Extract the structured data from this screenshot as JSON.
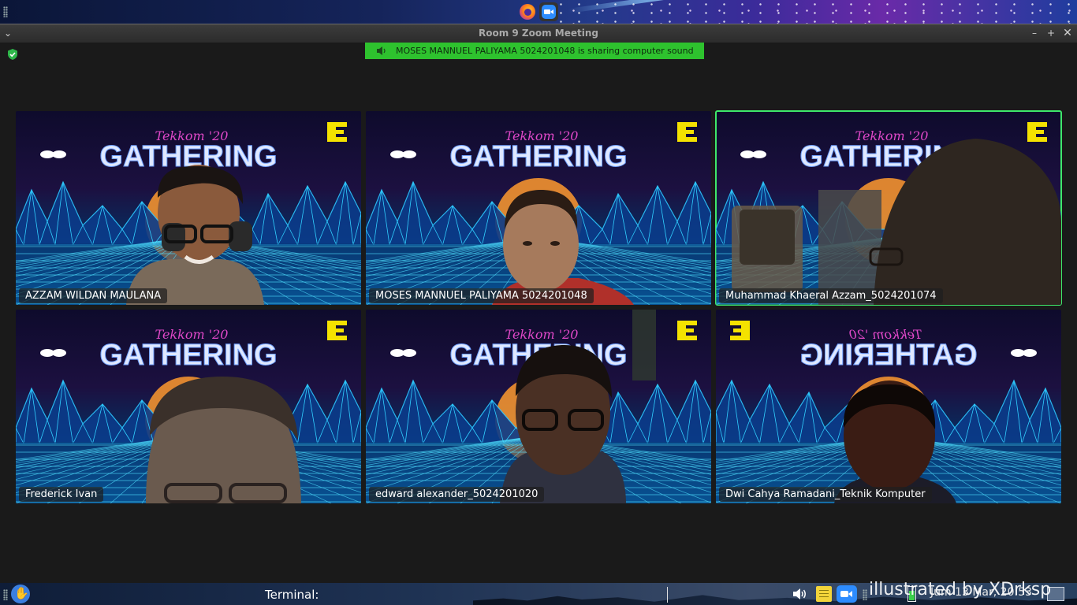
{
  "window": {
    "title": "Room 9   Zoom Meeting",
    "buttons": {
      "menu": "⌄",
      "minimize": "–",
      "maximize": "+",
      "close": "✕"
    }
  },
  "banner": {
    "text": "MOSES MANNUEL PALIYAMA 5024201048 is sharing computer sound",
    "color": "#2ec22e"
  },
  "tiles": [
    {
      "name": "AZZAM WILDAN MAULANA",
      "active": false
    },
    {
      "name": "MOSES MANNUEL PALIYAMA 5024201048",
      "active": false
    },
    {
      "name": "Muhammad Khaeral Azzam_5024201074",
      "active": true
    },
    {
      "name": "Frederick Ivan",
      "active": false
    },
    {
      "name": "edward alexander_5024201020",
      "active": false
    },
    {
      "name": "Dwi Cahya Ramadani_Teknik Komputer",
      "active": false
    }
  ],
  "background": {
    "title": "GATHERING",
    "subtitle": "Tekkom '20",
    "mirrored_title": "GATHERING"
  },
  "taskbar": {
    "terminal": "Terminal:",
    "clock": "Jum 13 Mar, 20:53"
  },
  "watermark": "illustrated by XDrksp",
  "icons": {
    "top_panel": [
      "firefox-icon",
      "zoom-icon"
    ],
    "tray": [
      "volume-icon",
      "notes-icon",
      "zoom-icon",
      "battery-icon",
      "desktop-icon"
    ]
  },
  "colors": {
    "active_border": "#3ee86a",
    "zoom_blue": "#2d8cff"
  }
}
